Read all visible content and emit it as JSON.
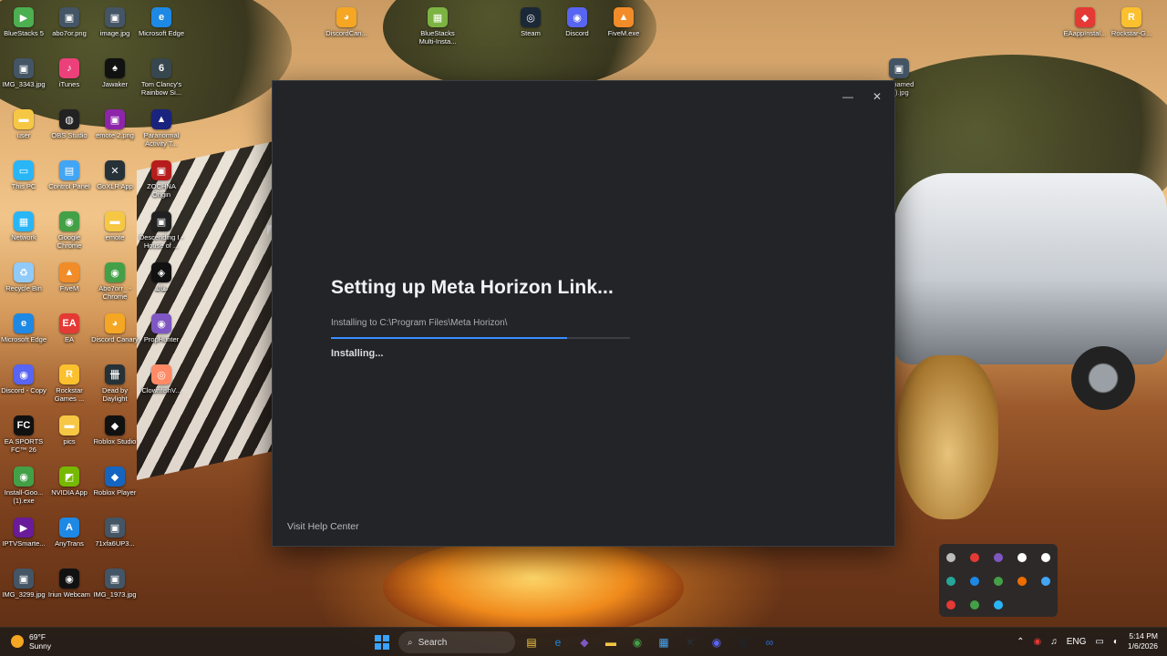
{
  "desktop_icons": [
    {
      "label": "BlueStacks 5",
      "color": "#4caf50",
      "glyph": "▶"
    },
    {
      "label": "abo7or.png",
      "color": "#445566",
      "glyph": "▣"
    },
    {
      "label": "image.jpg",
      "color": "#445566",
      "glyph": "▣"
    },
    {
      "label": "Microsoft Edge",
      "color": "#1e88e5",
      "glyph": "e"
    },
    {
      "label": "DiscordCan...",
      "color": "#f5a623",
      "glyph": "◕"
    },
    {
      "label": "BlueStacks Multi-Insta...",
      "color": "#7cb342",
      "glyph": "▦"
    },
    {
      "label": "Steam",
      "color": "#1b2838",
      "glyph": "◎"
    },
    {
      "label": "Discord",
      "color": "#5865f2",
      "glyph": "◉"
    },
    {
      "label": "FiveM.exe",
      "color": "#f28c28",
      "glyph": "▲"
    },
    {
      "label": "EAappInstal...",
      "color": "#e53935",
      "glyph": "◆"
    },
    {
      "label": "Rockstar-G...",
      "color": "#fbc02d",
      "glyph": "R"
    },
    {
      "label": "IMG_3343.jpg",
      "color": "#445566",
      "glyph": "▣"
    },
    {
      "label": "iTunes",
      "color": "#ec407a",
      "glyph": "♪"
    },
    {
      "label": "Jawaker",
      "color": "#111111",
      "glyph": "♠"
    },
    {
      "label": "Tom Clancy's Rainbow Si...",
      "color": "#37474f",
      "glyph": "6"
    },
    {
      "label": "Unnamed (1).jpg",
      "color": "#445566",
      "glyph": "▣"
    },
    {
      "label": "user",
      "color": "#f6c744",
      "glyph": "▬"
    },
    {
      "label": "OBS Studio",
      "color": "#222222",
      "glyph": "◍"
    },
    {
      "label": "emote 2.png",
      "color": "#8e24aa",
      "glyph": "▣"
    },
    {
      "label": "Paranormal Activity T...",
      "color": "#1a237e",
      "glyph": "▲"
    },
    {
      "label": "This PC",
      "color": "#29b6f6",
      "glyph": "▭"
    },
    {
      "label": "Control Panel",
      "color": "#42a5f5",
      "glyph": "▤"
    },
    {
      "label": "GoXLR App",
      "color": "#263238",
      "glyph": "✕"
    },
    {
      "label": "ZOCHNA Origin",
      "color": "#b71c1c",
      "glyph": "▣"
    },
    {
      "label": "Network",
      "color": "#29b6f6",
      "glyph": "▦"
    },
    {
      "label": "Google Chrome",
      "color": "#43a047",
      "glyph": "◉"
    },
    {
      "label": "emote",
      "color": "#f6c744",
      "glyph": "▬"
    },
    {
      "label": "Descending I - House of ...",
      "color": "#212121",
      "glyph": "▣"
    },
    {
      "label": "Recycle Bin",
      "color": "#90caf9",
      "glyph": "♻"
    },
    {
      "label": "FiveM",
      "color": "#f28c28",
      "glyph": "▲"
    },
    {
      "label": "Abo7orr_ - Chrome",
      "color": "#43a047",
      "glyph": "◉"
    },
    {
      "label": "نقالة",
      "color": "#111111",
      "glyph": "◈"
    },
    {
      "label": "Microsoft Edge",
      "color": "#1e88e5",
      "glyph": "e"
    },
    {
      "label": "EA",
      "color": "#e53935",
      "glyph": "EA"
    },
    {
      "label": "Discord Canary",
      "color": "#f5a623",
      "glyph": "◕"
    },
    {
      "label": "PropHunter",
      "color": "#7e57c2",
      "glyph": "◉"
    },
    {
      "label": "Discord - Copy",
      "color": "#5865f2",
      "glyph": "◉"
    },
    {
      "label": "Rockstar Games ...",
      "color": "#fbc02d",
      "glyph": "R"
    },
    {
      "label": "Dead by Daylight",
      "color": "#263238",
      "glyph": "卌"
    },
    {
      "label": "ClownfishV...",
      "color": "#ff8a65",
      "glyph": "◎"
    },
    {
      "label": "EA SPORTS FC™ 26",
      "color": "#111111",
      "glyph": "FC"
    },
    {
      "label": "pics",
      "color": "#f6c744",
      "glyph": "▬"
    },
    {
      "label": "Roblox Studio",
      "color": "#111111",
      "glyph": "◆"
    },
    {
      "label": "Install-Goo... (1).exe",
      "color": "#43a047",
      "glyph": "◉"
    },
    {
      "label": "NVIDIA App",
      "color": "#76b900",
      "glyph": "◩"
    },
    {
      "label": "Roblox Player",
      "color": "#1565c0",
      "glyph": "◆"
    },
    {
      "label": "IPTVSmarte...",
      "color": "#6a1b9a",
      "glyph": "▶"
    },
    {
      "label": "AnyTrans",
      "color": "#1e88e5",
      "glyph": "A"
    },
    {
      "label": "71xfa6UP3...",
      "color": "#445566",
      "glyph": "▣"
    },
    {
      "label": "IMG_3299.jpg",
      "color": "#445566",
      "glyph": "▣"
    },
    {
      "label": "Iriun Webcam",
      "color": "#111111",
      "glyph": "◉"
    },
    {
      "label": "IMG_1973.jpg",
      "color": "#445566",
      "glyph": "▣"
    }
  ],
  "installer": {
    "title": "Setting up Meta Horizon Link...",
    "install_path": "Installing to C:\\Program Files\\Meta Horizon\\",
    "status": "Installing...",
    "progress_percent": 79,
    "help_link": "Visit Help Center",
    "minimize_glyph": "—",
    "close_glyph": "✕",
    "accent": "#3a8cff"
  },
  "tray_overflow": [
    "#bdbdbd",
    "#e53935",
    "#7e57c2",
    "#ffffff",
    "#ffffff",
    "#26a69a",
    "#1e88e5",
    "#43a047",
    "#ef6c00",
    "#42a5f5",
    "#e53935",
    "#43a047",
    "#29b6f6"
  ],
  "taskbar": {
    "weather_temp": "69°F",
    "weather_desc": "Sunny",
    "search_label": "Search",
    "language": "ENG",
    "time": "5:14 PM",
    "date": "1/6/2026",
    "apps": [
      {
        "name": "file-explorer-icon",
        "glyph": "▤",
        "color": "#f6c744"
      },
      {
        "name": "edge-icon",
        "glyph": "e",
        "color": "#1e88e5"
      },
      {
        "name": "copilot-icon",
        "glyph": "◆",
        "color": "#7e57c2"
      },
      {
        "name": "folder-icon",
        "glyph": "▬",
        "color": "#f6c744"
      },
      {
        "name": "chrome-icon",
        "glyph": "◉",
        "color": "#43a047"
      },
      {
        "name": "store-icon",
        "glyph": "▦",
        "color": "#42a5f5"
      },
      {
        "name": "goxlr-icon",
        "glyph": "✕",
        "color": "#263238"
      },
      {
        "name": "discord-icon",
        "glyph": "◉",
        "color": "#5865f2"
      },
      {
        "name": "steam-icon",
        "glyph": "◎",
        "color": "#1b2838"
      },
      {
        "name": "meta-icon",
        "glyph": "∞",
        "color": "#2b6fd6"
      }
    ]
  }
}
